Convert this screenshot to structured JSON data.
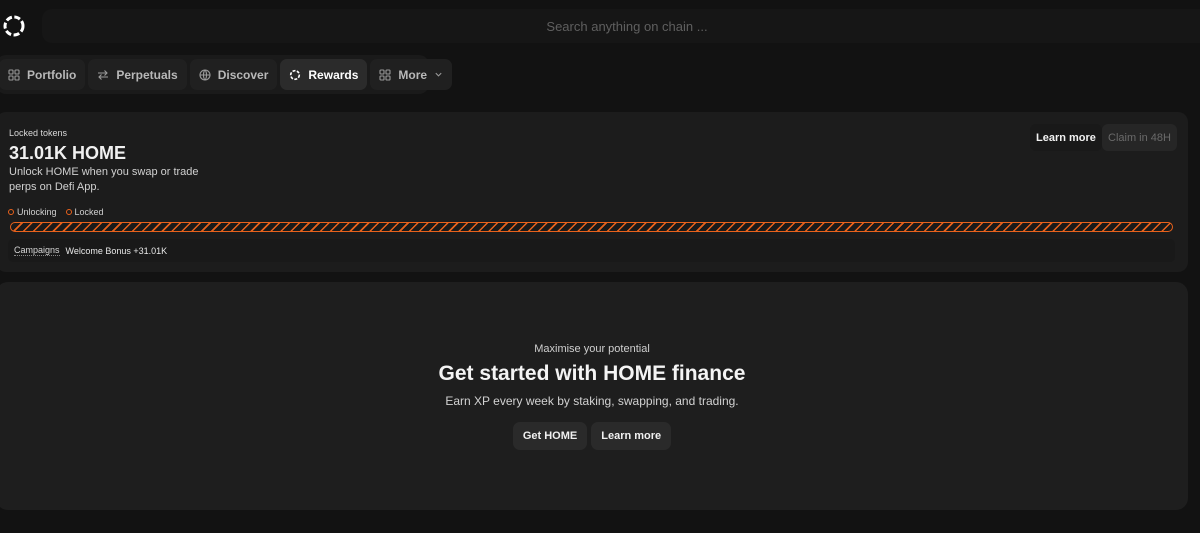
{
  "search": {
    "placeholder": "Search anything on chain ..."
  },
  "nav": {
    "items": [
      {
        "label": "Portfolio",
        "icon": "grid-icon"
      },
      {
        "label": "Perpetuals",
        "icon": "arrows-swap-icon"
      },
      {
        "label": "Discover",
        "icon": "globe-icon"
      },
      {
        "label": "Rewards",
        "icon": "ring-icon",
        "active": true
      },
      {
        "label": "More",
        "icon": "grid-icon"
      }
    ]
  },
  "locked": {
    "label": "Locked tokens",
    "amount": "31.01K HOME",
    "description": "Unlock HOME when you swap or trade perps on Defi App.",
    "learn_more": "Learn more",
    "claim": "Claim in 48H",
    "legend_unlocking": "Unlocking",
    "legend_locked": "Locked",
    "unlocked_fraction": 0,
    "campaigns_label": "Campaigns",
    "campaign_value": "Welcome Bonus +31.01K"
  },
  "hero": {
    "subtitle": "Maximise your potential",
    "title": "Get started with HOME finance",
    "description": "Earn XP every week by staking, swapping, and trading.",
    "get_button": "Get HOME",
    "learn_button": "Learn more"
  },
  "colors": {
    "accent": "#e8621c",
    "background": "#121212"
  }
}
